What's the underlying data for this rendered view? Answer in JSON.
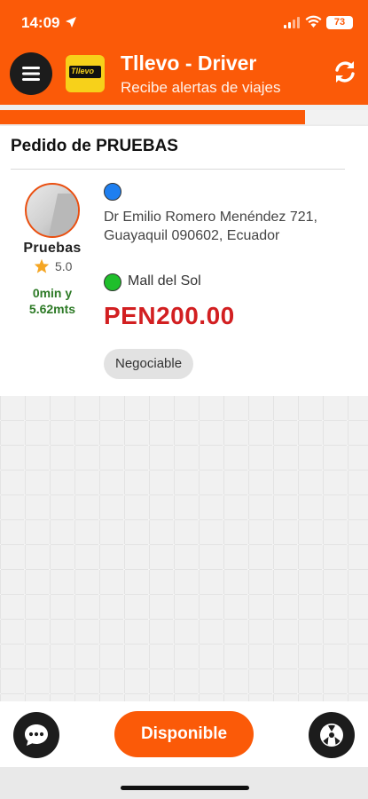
{
  "status_bar": {
    "time": "14:09",
    "battery": "73",
    "icons": [
      "location-arrow-icon",
      "signal-icon",
      "wifi-icon",
      "battery-icon"
    ]
  },
  "app_bar": {
    "title": "Tllevo - Driver",
    "subtitle": "Recibe alertas de viajes",
    "logo_text": "Tllevo",
    "icons": [
      "menu-icon",
      "refresh-icon"
    ]
  },
  "progress": {
    "fraction": 0.83,
    "color": "#fb5a08"
  },
  "order": {
    "title": "Pedido de PRUEBAS",
    "passenger": {
      "name": "Pruebas",
      "rating": "5.0",
      "eta_line1": "0min y",
      "eta_line2": "5.62mts"
    },
    "origin": "Dr Emilio Romero Menéndez 721, Guayaquil 090602, Ecuador",
    "destination": "Mall del Sol",
    "price": "PEN200.00",
    "tag": "Negociable"
  },
  "bottom": {
    "available_label": "Disponible",
    "icons": [
      "chat-icon",
      "sos-icon"
    ]
  },
  "colors": {
    "brand_orange": "#fb5a08",
    "price_red": "#d21f21",
    "eta_green": "#2d7a26",
    "origin_blue": "#1e7ff0",
    "dest_green": "#1fbf2b"
  }
}
